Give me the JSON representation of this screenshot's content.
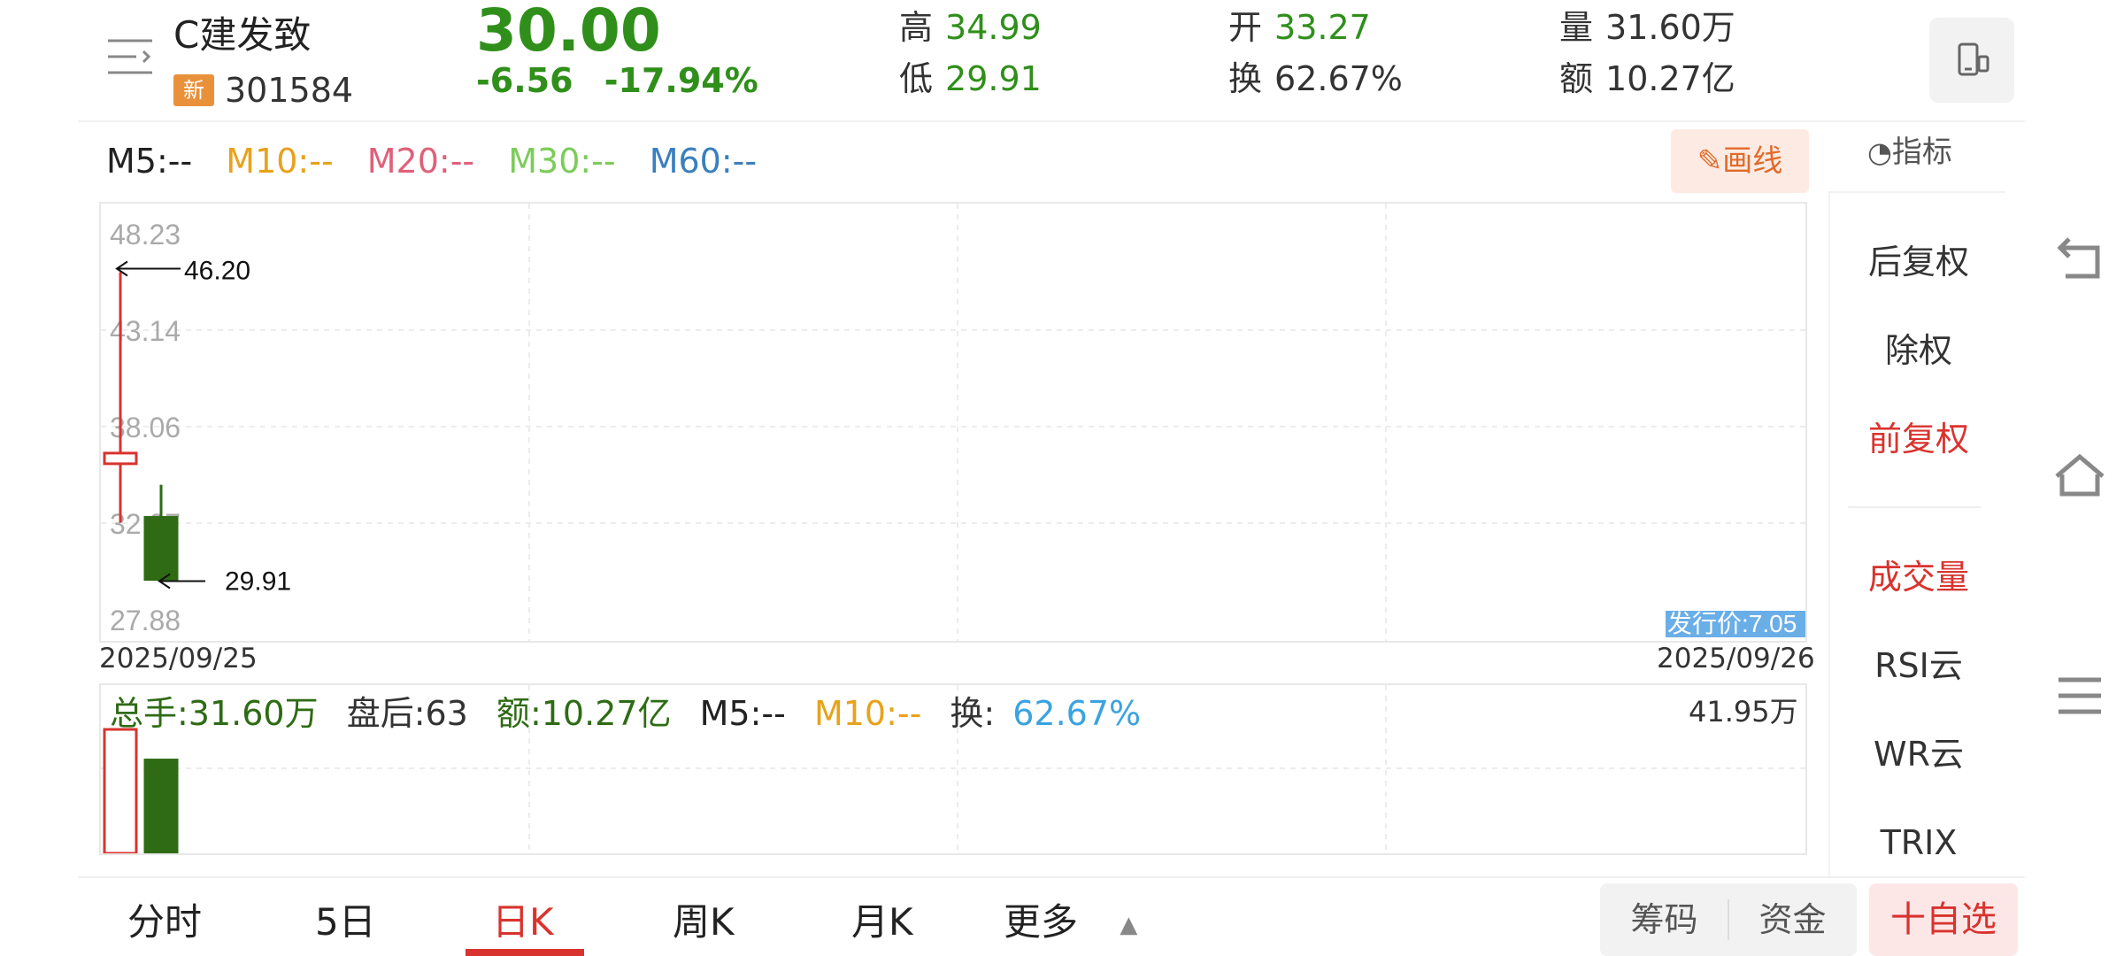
{
  "header": {
    "name": "C建发致",
    "badge": "新",
    "code": "301584",
    "price": "30.00",
    "change": "-6.56",
    "change_pct": "-17.94%",
    "stats": {
      "high_label": "高",
      "high": "34.99",
      "low_label": "低",
      "low": "29.91",
      "open_label": "开",
      "open": "33.27",
      "turnover_label": "换",
      "turnover": "62.67%",
      "volume_label": "量",
      "volume": "31.60万",
      "amount_label": "额",
      "amount": "10.27亿"
    }
  },
  "ma": {
    "m5": "M5:--",
    "m10": "M10:--",
    "m20": "M20:--",
    "m30": "M30:--",
    "m60": "M60:--"
  },
  "tools": {
    "draw": "画线",
    "indicator": "指标"
  },
  "chart_data": {
    "type": "candlestick",
    "y_ticks": [
      "48.23",
      "43.14",
      "38.06",
      "32.97",
      "27.88"
    ],
    "ylim": [
      27.88,
      48.23
    ],
    "x_labels": [
      "2025/09/25",
      "2025/09/26"
    ],
    "candles": [
      {
        "date": "2025/09/25",
        "open": 36.2,
        "close": 36.56,
        "high": 46.2,
        "low": 33.0,
        "color": "#d9332f",
        "hollow": true
      },
      {
        "date": "2025/09/26",
        "open": 33.27,
        "close": 30.0,
        "high": 34.99,
        "low": 29.91,
        "color": "#2e6b14",
        "hollow": false
      }
    ],
    "annotations": {
      "max_label": "46.20",
      "min_label": "29.91",
      "issue_price": "发行价:7.05"
    },
    "volume": {
      "max_label": "41.95万",
      "ylim": [
        0,
        41.95
      ],
      "bars": [
        {
          "value": 41.95,
          "color": "#d9332f",
          "hollow": true
        },
        {
          "value": 31.6,
          "color": "#2e6b14",
          "hollow": false
        }
      ]
    }
  },
  "volume_info": {
    "total": "总手:31.60万",
    "after": "盘后:63",
    "amount": "额:10.27亿",
    "m5": "M5:--",
    "m10": "M10:--",
    "turnover_label": "换:",
    "turnover_value": "62.67%"
  },
  "side_panel": {
    "items": [
      "后复权",
      "除权",
      "前复权",
      "成交量",
      "RSI云",
      "WR云",
      "TRIX"
    ]
  },
  "bottom_tabs": [
    "分时",
    "5日",
    "日K",
    "周K",
    "月K",
    "更多"
  ],
  "bottom_chips": {
    "chips": "筹码",
    "funds": "资金",
    "favorite": "十自选"
  },
  "colors": {
    "down": "#2f8f1a",
    "up": "#d9332f",
    "m10": "#e8a21c",
    "m20": "#e0607a",
    "m30": "#7ccc5a",
    "m60": "#3a7fbf",
    "turnover": "#3aa3e0"
  }
}
